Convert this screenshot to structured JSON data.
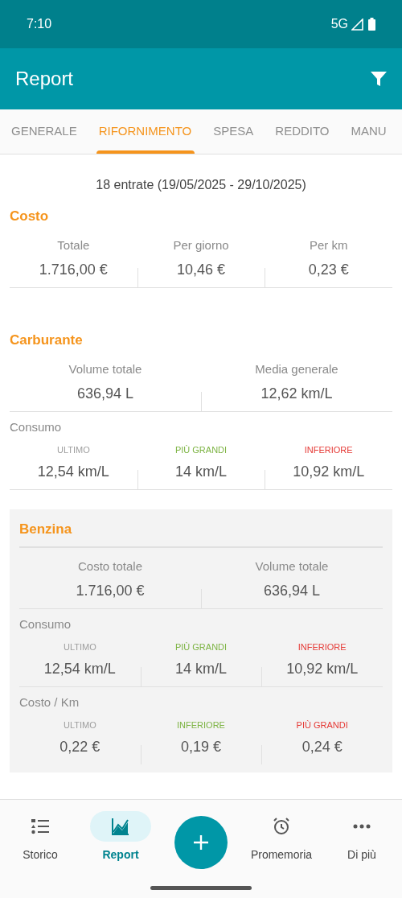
{
  "status_bar": {
    "time": "7:10",
    "network": "5G"
  },
  "app_bar": {
    "title": "Report"
  },
  "tabs": [
    {
      "label": "GENERALE",
      "selected": false
    },
    {
      "label": "RIFORNIMENTO",
      "selected": true
    },
    {
      "label": "SPESA",
      "selected": false
    },
    {
      "label": "REDDITO",
      "selected": false
    },
    {
      "label": "MANU",
      "selected": false
    }
  ],
  "summary": "18 entrate (19/05/2025 - 29/10/2025)",
  "sections": [
    {
      "title": "Costo",
      "panel": false,
      "groups": [
        {
          "kind": "main",
          "cells": [
            {
              "label": "Totale",
              "value": "1.716,00 €"
            },
            {
              "label": "Per giorno",
              "value": "10,46 €"
            },
            {
              "label": "Per km",
              "value": "0,23 €"
            }
          ]
        }
      ]
    },
    {
      "title": "Carburante",
      "panel": false,
      "groups": [
        {
          "kind": "main",
          "cells": [
            {
              "label": "Volume totale",
              "value": "636,94 L"
            },
            {
              "label": "Media generale",
              "value": "12,62 km/L"
            }
          ]
        },
        {
          "kind": "detail",
          "heading": "Consumo",
          "cells": [
            {
              "label": "ULTIMO",
              "color": "#9e9e9e",
              "value": "12,54 km/L"
            },
            {
              "label": "PIÙ GRANDI",
              "color": "#7cb342",
              "value": "14 km/L"
            },
            {
              "label": "INFERIORE",
              "color": "#e53935",
              "value": "10,92 km/L"
            }
          ]
        }
      ]
    },
    {
      "title": "Benzina",
      "panel": true,
      "groups": [
        {
          "kind": "main",
          "cells": [
            {
              "label": "Costo totale",
              "value": "1.716,00 €"
            },
            {
              "label": "Volume totale",
              "value": "636,94 L"
            }
          ]
        },
        {
          "kind": "detail",
          "heading": "Consumo",
          "cells": [
            {
              "label": "ULTIMO",
              "color": "#9e9e9e",
              "value": "12,54 km/L"
            },
            {
              "label": "PIÙ GRANDI",
              "color": "#7cb342",
              "value": "14 km/L"
            },
            {
              "label": "INFERIORE",
              "color": "#e53935",
              "value": "10,92 km/L"
            }
          ]
        },
        {
          "kind": "detail",
          "heading": "Costo / Km",
          "cells": [
            {
              "label": "ULTIMO",
              "color": "#9e9e9e",
              "value": "0,22 €"
            },
            {
              "label": "INFERIORE",
              "color": "#7cb342",
              "value": "0,19 €"
            },
            {
              "label": "PIÙ GRANDI",
              "color": "#e53935",
              "value": "0,24 €"
            }
          ]
        }
      ]
    }
  ],
  "bottom_nav": [
    {
      "kind": "tab",
      "label": "Storico",
      "selected": false
    },
    {
      "kind": "tab",
      "label": "Report",
      "selected": true
    },
    {
      "kind": "fab"
    },
    {
      "kind": "tab",
      "label": "Promemoria",
      "selected": false
    },
    {
      "kind": "tab",
      "label": "Di più",
      "selected": false
    }
  ]
}
